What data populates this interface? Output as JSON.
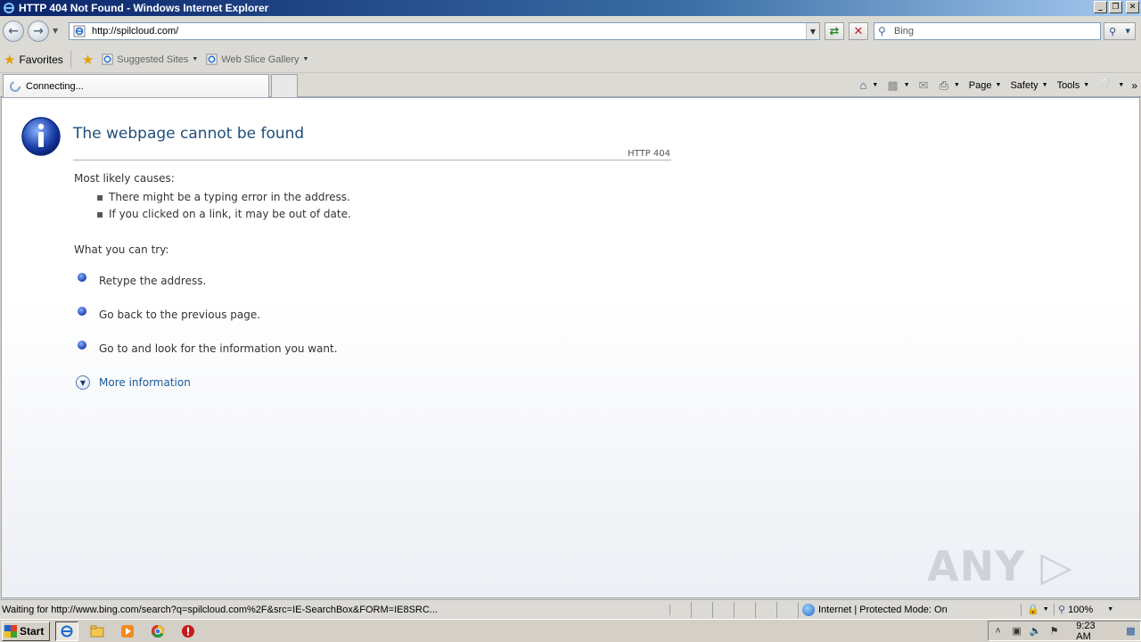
{
  "window": {
    "title": "HTTP 404 Not Found - Windows Internet Explorer",
    "minimize": "_",
    "restore": "❐",
    "close": "✕"
  },
  "address": {
    "url": "http://spilcloud.com/",
    "search_placeholder": "Bing"
  },
  "favorites": {
    "favorites_label": "Favorites",
    "suggested_sites": "Suggested Sites",
    "web_slice_gallery": "Web Slice Gallery"
  },
  "tab": {
    "label": "Connecting..."
  },
  "commands": {
    "page": "Page",
    "safety": "Safety",
    "tools": "Tools"
  },
  "content": {
    "title": "The webpage cannot be found",
    "http_code": "HTTP 404",
    "causes_heading": "Most likely causes:",
    "causes": [
      "There might be a typing error in the address.",
      "If you clicked on a link, it may be out of date."
    ],
    "try_heading": "What you can try:",
    "tries": [
      "Retype the address.",
      "Go back to the previous page.",
      "Go to  and look for the information you want."
    ],
    "more_information": "More information",
    "watermark": "ANY ▷ RUN"
  },
  "status": {
    "message": "Waiting for http://www.bing.com/search?q=spilcloud.com%2F&src=IE-SearchBox&FORM=IE8SRC...",
    "zone": "Internet | Protected Mode: On",
    "zoom": "100%"
  },
  "taskbar": {
    "start": "Start",
    "clock": "9:23 AM"
  },
  "colors": {
    "title_link": "#1f4e79",
    "link": "#1a5a9a"
  }
}
